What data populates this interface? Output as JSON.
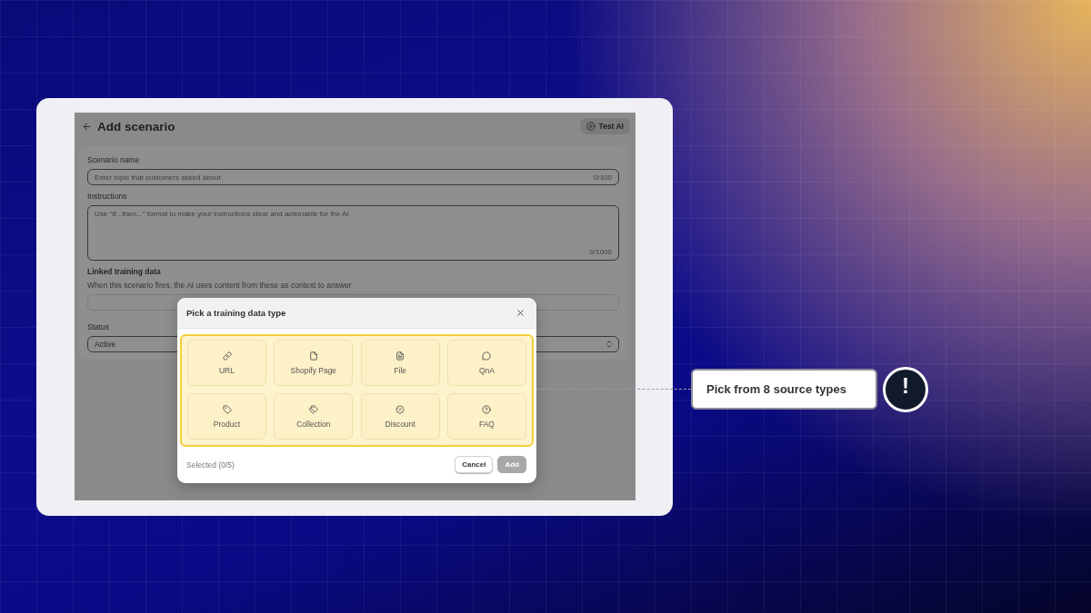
{
  "page": {
    "title": "Add scenario",
    "test_button": "Test AI",
    "fields": [
      {
        "kind": "input",
        "label": "Scenario name",
        "placeholder": "Enter topic that customers asked about",
        "counter": "0/100"
      },
      {
        "kind": "textarea",
        "label": "Instructions",
        "placeholder": "Use \"If...then...\" format to make your instructions clear and actionable for the AI",
        "counter": "0/1000"
      }
    ],
    "linked": {
      "title": "Linked training data",
      "description": "When this scenario fires, the AI uses content from these as context to answer"
    },
    "status": {
      "label": "Status",
      "value": "Active"
    }
  },
  "modal": {
    "title": "Pick a training data type",
    "options": [
      {
        "kind": "link",
        "label": "URL"
      },
      {
        "kind": "page",
        "label": "Shopify Page"
      },
      {
        "kind": "file",
        "label": "File"
      },
      {
        "kind": "qna",
        "label": "QnA"
      },
      {
        "kind": "product",
        "label": "Product"
      },
      {
        "kind": "collection",
        "label": "Collection"
      },
      {
        "kind": "discount",
        "label": "Discount"
      },
      {
        "kind": "faq",
        "label": "FAQ"
      }
    ],
    "selected_count": "Selected (0/5)",
    "buttons": [
      {
        "label": "Cancel",
        "disabled": false
      },
      {
        "label": "Add",
        "disabled": true
      }
    ]
  },
  "callout": {
    "text": "Pick from 8 source types",
    "badge": "!"
  }
}
